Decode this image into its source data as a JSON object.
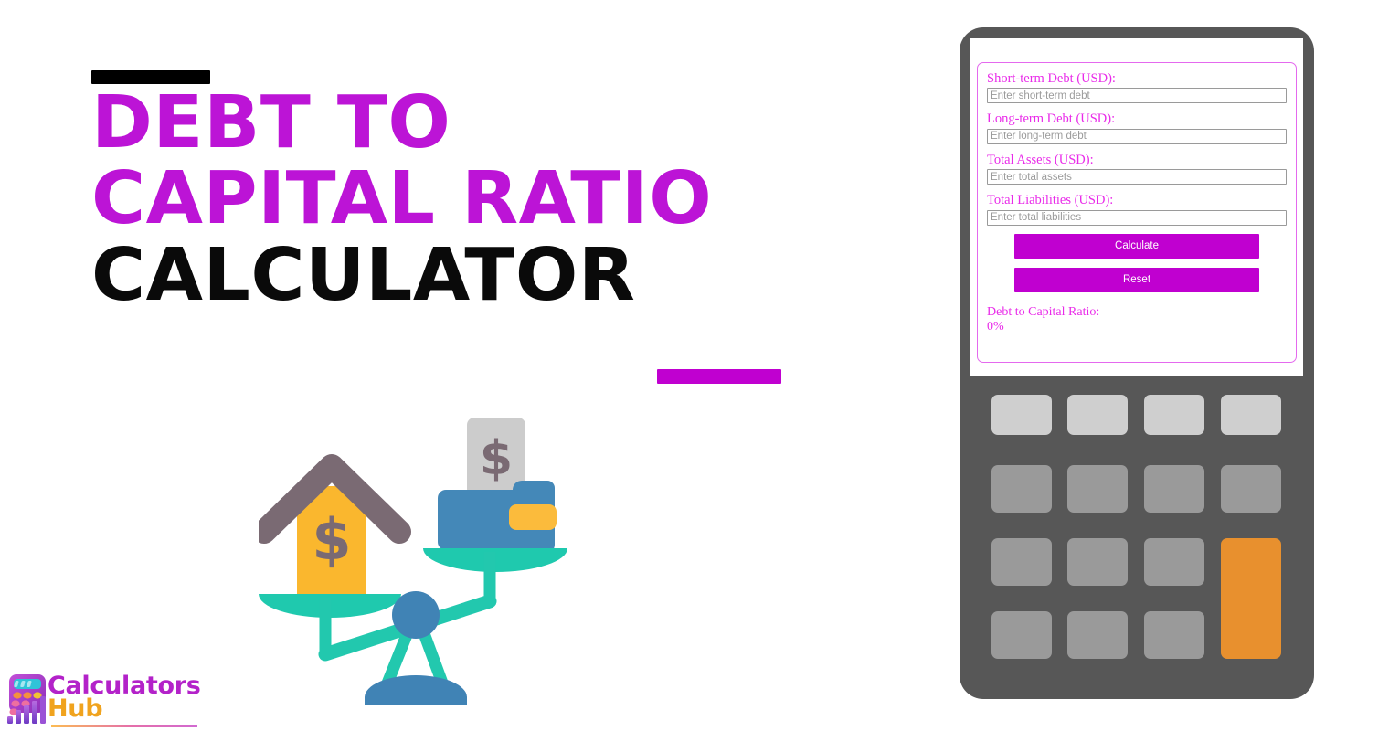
{
  "promo": {
    "headline_line1": "DEBT TO",
    "headline_line2": "CAPITAL RATIO",
    "headline_line3": "CALCULATOR",
    "headline_color_magenta": "#BC14D6",
    "headline_color_black": "#0A0A0A",
    "rule_top_color": "#000000",
    "rule_bottom_color": "#C000D0"
  },
  "illustration": {
    "name": "balance-scale-house-wallet",
    "colors": {
      "beam_teal": "#22C8AE",
      "pan_teal": "#1FC9AE",
      "pivot_blue": "#4083B5",
      "base_blue": "#4083B5",
      "house_body_yellow": "#FAB72E",
      "house_roof_gray": "#7A6A73",
      "wallet_blue": "#4488B8",
      "wallet_clasp_yellow": "#FBBB3C",
      "bill_gray": "#CCCCCC",
      "dollar_gray": "#7A6A73"
    }
  },
  "logo": {
    "word1": "Calculators",
    "word2": "Hub",
    "word1_color": "#B322C9",
    "word2_color": "#F0A31E",
    "mark_name": "calculator-bar-chart-logo-icon"
  },
  "device": {
    "frame_color": "#575757",
    "screen_color": "#FFFFFF",
    "panel_border_color": "#E469EE"
  },
  "calculator": {
    "fields": [
      {
        "id": "short-term-debt",
        "label": "Short-term Debt (USD):",
        "placeholder": "Enter short-term debt",
        "value": ""
      },
      {
        "id": "long-term-debt",
        "label": "Long-term Debt (USD):",
        "placeholder": "Enter long-term debt",
        "value": ""
      },
      {
        "id": "total-assets",
        "label": "Total Assets (USD):",
        "placeholder": "Enter total assets",
        "value": ""
      },
      {
        "id": "total-liabilities",
        "label": "Total Liabilities (USD):",
        "placeholder": "Enter total liabilities",
        "value": ""
      }
    ],
    "buttons": {
      "calculate": "Calculate",
      "reset": "Reset",
      "color": "#C000D0",
      "text_color": "#FFFFFF"
    },
    "result": {
      "label": "Debt to Capital Ratio:",
      "value": "0%",
      "color": "#E92BE9"
    }
  },
  "keypad": {
    "rows": 4,
    "cols": 4,
    "top_row_color": "#CFCFCF",
    "key_color": "#9A9A9A",
    "accent_key_color": "#E8902E",
    "accent_key_spans_rows": [
      3,
      4
    ]
  }
}
